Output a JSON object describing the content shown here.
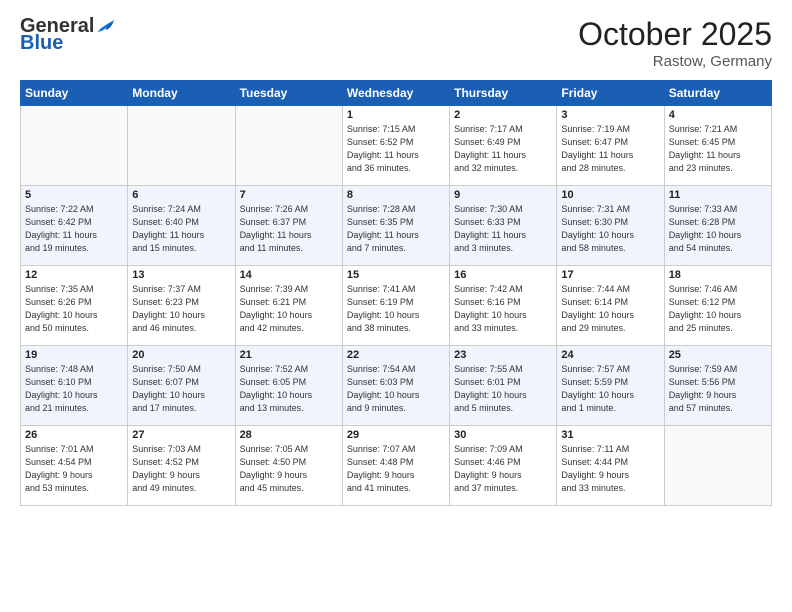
{
  "header": {
    "month_title": "October 2025",
    "subtitle": "Rastow, Germany",
    "days": [
      "Sunday",
      "Monday",
      "Tuesday",
      "Wednesday",
      "Thursday",
      "Friday",
      "Saturday"
    ]
  },
  "weeks": [
    {
      "shaded": false,
      "days": [
        {
          "num": "",
          "info": "",
          "empty": true
        },
        {
          "num": "",
          "info": "",
          "empty": true
        },
        {
          "num": "",
          "info": "",
          "empty": true
        },
        {
          "num": "1",
          "info": "Sunrise: 7:15 AM\nSunset: 6:52 PM\nDaylight: 11 hours\nand 36 minutes.",
          "empty": false
        },
        {
          "num": "2",
          "info": "Sunrise: 7:17 AM\nSunset: 6:49 PM\nDaylight: 11 hours\nand 32 minutes.",
          "empty": false
        },
        {
          "num": "3",
          "info": "Sunrise: 7:19 AM\nSunset: 6:47 PM\nDaylight: 11 hours\nand 28 minutes.",
          "empty": false
        },
        {
          "num": "4",
          "info": "Sunrise: 7:21 AM\nSunset: 6:45 PM\nDaylight: 11 hours\nand 23 minutes.",
          "empty": false
        }
      ]
    },
    {
      "shaded": true,
      "days": [
        {
          "num": "5",
          "info": "Sunrise: 7:22 AM\nSunset: 6:42 PM\nDaylight: 11 hours\nand 19 minutes.",
          "empty": false
        },
        {
          "num": "6",
          "info": "Sunrise: 7:24 AM\nSunset: 6:40 PM\nDaylight: 11 hours\nand 15 minutes.",
          "empty": false
        },
        {
          "num": "7",
          "info": "Sunrise: 7:26 AM\nSunset: 6:37 PM\nDaylight: 11 hours\nand 11 minutes.",
          "empty": false
        },
        {
          "num": "8",
          "info": "Sunrise: 7:28 AM\nSunset: 6:35 PM\nDaylight: 11 hours\nand 7 minutes.",
          "empty": false
        },
        {
          "num": "9",
          "info": "Sunrise: 7:30 AM\nSunset: 6:33 PM\nDaylight: 11 hours\nand 3 minutes.",
          "empty": false
        },
        {
          "num": "10",
          "info": "Sunrise: 7:31 AM\nSunset: 6:30 PM\nDaylight: 10 hours\nand 58 minutes.",
          "empty": false
        },
        {
          "num": "11",
          "info": "Sunrise: 7:33 AM\nSunset: 6:28 PM\nDaylight: 10 hours\nand 54 minutes.",
          "empty": false
        }
      ]
    },
    {
      "shaded": false,
      "days": [
        {
          "num": "12",
          "info": "Sunrise: 7:35 AM\nSunset: 6:26 PM\nDaylight: 10 hours\nand 50 minutes.",
          "empty": false
        },
        {
          "num": "13",
          "info": "Sunrise: 7:37 AM\nSunset: 6:23 PM\nDaylight: 10 hours\nand 46 minutes.",
          "empty": false
        },
        {
          "num": "14",
          "info": "Sunrise: 7:39 AM\nSunset: 6:21 PM\nDaylight: 10 hours\nand 42 minutes.",
          "empty": false
        },
        {
          "num": "15",
          "info": "Sunrise: 7:41 AM\nSunset: 6:19 PM\nDaylight: 10 hours\nand 38 minutes.",
          "empty": false
        },
        {
          "num": "16",
          "info": "Sunrise: 7:42 AM\nSunset: 6:16 PM\nDaylight: 10 hours\nand 33 minutes.",
          "empty": false
        },
        {
          "num": "17",
          "info": "Sunrise: 7:44 AM\nSunset: 6:14 PM\nDaylight: 10 hours\nand 29 minutes.",
          "empty": false
        },
        {
          "num": "18",
          "info": "Sunrise: 7:46 AM\nSunset: 6:12 PM\nDaylight: 10 hours\nand 25 minutes.",
          "empty": false
        }
      ]
    },
    {
      "shaded": true,
      "days": [
        {
          "num": "19",
          "info": "Sunrise: 7:48 AM\nSunset: 6:10 PM\nDaylight: 10 hours\nand 21 minutes.",
          "empty": false
        },
        {
          "num": "20",
          "info": "Sunrise: 7:50 AM\nSunset: 6:07 PM\nDaylight: 10 hours\nand 17 minutes.",
          "empty": false
        },
        {
          "num": "21",
          "info": "Sunrise: 7:52 AM\nSunset: 6:05 PM\nDaylight: 10 hours\nand 13 minutes.",
          "empty": false
        },
        {
          "num": "22",
          "info": "Sunrise: 7:54 AM\nSunset: 6:03 PM\nDaylight: 10 hours\nand 9 minutes.",
          "empty": false
        },
        {
          "num": "23",
          "info": "Sunrise: 7:55 AM\nSunset: 6:01 PM\nDaylight: 10 hours\nand 5 minutes.",
          "empty": false
        },
        {
          "num": "24",
          "info": "Sunrise: 7:57 AM\nSunset: 5:59 PM\nDaylight: 10 hours\nand 1 minute.",
          "empty": false
        },
        {
          "num": "25",
          "info": "Sunrise: 7:59 AM\nSunset: 5:56 PM\nDaylight: 9 hours\nand 57 minutes.",
          "empty": false
        }
      ]
    },
    {
      "shaded": false,
      "days": [
        {
          "num": "26",
          "info": "Sunrise: 7:01 AM\nSunset: 4:54 PM\nDaylight: 9 hours\nand 53 minutes.",
          "empty": false
        },
        {
          "num": "27",
          "info": "Sunrise: 7:03 AM\nSunset: 4:52 PM\nDaylight: 9 hours\nand 49 minutes.",
          "empty": false
        },
        {
          "num": "28",
          "info": "Sunrise: 7:05 AM\nSunset: 4:50 PM\nDaylight: 9 hours\nand 45 minutes.",
          "empty": false
        },
        {
          "num": "29",
          "info": "Sunrise: 7:07 AM\nSunset: 4:48 PM\nDaylight: 9 hours\nand 41 minutes.",
          "empty": false
        },
        {
          "num": "30",
          "info": "Sunrise: 7:09 AM\nSunset: 4:46 PM\nDaylight: 9 hours\nand 37 minutes.",
          "empty": false
        },
        {
          "num": "31",
          "info": "Sunrise: 7:11 AM\nSunset: 4:44 PM\nDaylight: 9 hours\nand 33 minutes.",
          "empty": false
        },
        {
          "num": "",
          "info": "",
          "empty": true
        }
      ]
    }
  ]
}
